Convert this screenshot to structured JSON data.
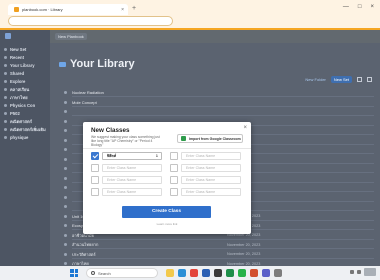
{
  "browser": {
    "tab_title": "planbook.com · Library",
    "tab_close": "×",
    "new_tab": "+",
    "window_controls": [
      "—",
      "□",
      "×"
    ]
  },
  "topbar": {
    "items": [
      "New Planbook"
    ]
  },
  "sidebar": {
    "items": [
      {
        "label": "New Set"
      },
      {
        "label": "Recent"
      },
      {
        "label": "Your Library"
      },
      {
        "label": "Shared"
      },
      {
        "label": "Explore"
      },
      {
        "label": "คลาสเรียน"
      },
      {
        "label": "ภาษาไทย"
      },
      {
        "label": "Physics Con"
      },
      {
        "label": "P502"
      },
      {
        "label": "คณิตศาสตร์"
      },
      {
        "label": "คณิตศาสตร์เพิ่มเติม"
      },
      {
        "label": "physique"
      }
    ]
  },
  "library": {
    "title": "Your Library",
    "actions": {
      "new_folder": "New Folder",
      "new_set": "New Set"
    },
    "rows": [
      {
        "name": "Nuclear Radiation",
        "date": ""
      },
      {
        "name": "Mole Concept",
        "date": ""
      },
      {
        "name": "",
        "date": ""
      },
      {
        "name": "",
        "date": ""
      },
      {
        "name": "",
        "date": ""
      },
      {
        "name": "",
        "date": ""
      },
      {
        "name": "",
        "date": ""
      },
      {
        "name": "",
        "date": ""
      },
      {
        "name": "",
        "date": ""
      },
      {
        "name": "",
        "date": ""
      },
      {
        "name": "",
        "date": ""
      },
      {
        "name": "",
        "date": ""
      },
      {
        "name": "",
        "date": ""
      },
      {
        "name": "Unit 10",
        "date": "November 20, 2023"
      },
      {
        "name": "Ecosystem/Food Webs",
        "date": "November 20, 2023"
      },
      {
        "name": "อาชีวอนามัย",
        "date": "November 20, 2023"
      },
      {
        "name": "สำนวนไทยยาก",
        "date": "November 20, 2023"
      },
      {
        "name": "ประวัติศาสตร์",
        "date": "November 20, 2023"
      },
      {
        "name": "ภาษาไทย",
        "date": "November 20, 2023"
      }
    ]
  },
  "modal": {
    "title": "New Classes",
    "subtitle": "We suggest making your class something just like long title \"AP Chemistry\" or \"Period 4 Biology\"",
    "google_button": "Import from Google Classroom",
    "close": "×",
    "fields": [
      {
        "value": "ฟิสิกส์",
        "checked": true,
        "grade": "1"
      },
      {
        "placeholder": "Enter Class Name",
        "checked": false
      },
      {
        "placeholder": "Enter Class Name",
        "checked": false
      },
      {
        "placeholder": "Enter Class Name",
        "checked": false
      },
      {
        "placeholder": "Enter Class Name",
        "checked": false
      },
      {
        "placeholder": "Enter Class Name",
        "checked": false
      },
      {
        "placeholder": "Enter Class Name",
        "checked": false
      },
      {
        "placeholder": "Enter Class Name",
        "checked": false
      }
    ],
    "create_button": "Create Class",
    "create_sub": "Learn more link"
  },
  "taskbar": {
    "search_placeholder": "Search",
    "icons": [
      "file-explorer-icon",
      "edge-icon",
      "chrome-icon",
      "word-icon",
      "store-icon",
      "excel-icon",
      "line-icon",
      "powerpoint-icon",
      "teams-icon",
      "settings-icon"
    ]
  },
  "colors": {
    "accent": "#2f6fcb",
    "overlay": "#5b6370",
    "browser_border": "#f5a623"
  }
}
